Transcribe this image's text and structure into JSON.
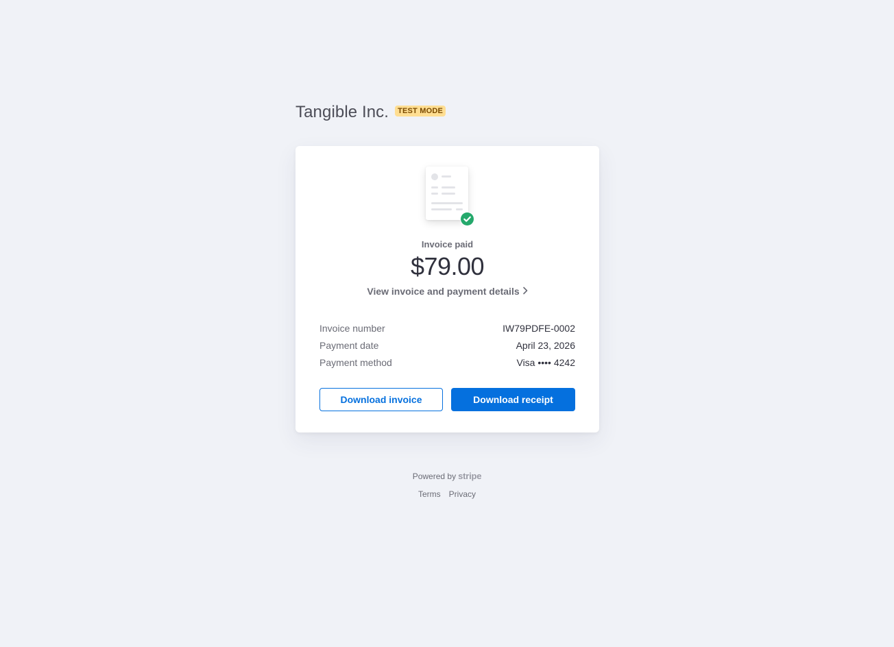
{
  "merchant": {
    "name": "Tangible Inc.",
    "badge": "TEST MODE"
  },
  "invoice": {
    "status": "Invoice paid",
    "amount": "$79.00",
    "details_link": "View invoice and payment details",
    "icons": {
      "document": "invoice-document-icon",
      "check": "check-circle-icon",
      "chevron": "chevron-right-icon"
    },
    "colors": {
      "accent": "#0570de",
      "success": "#24a86b",
      "badge_bg": "#ffde92"
    },
    "summary": [
      {
        "label": "Invoice number",
        "value": "IW79PDFE-0002"
      },
      {
        "label": "Payment date",
        "value": "April 23, 2026"
      },
      {
        "label": "Payment method",
        "value": "Visa •••• 4242"
      }
    ]
  },
  "actions": {
    "download_invoice": "Download invoice",
    "download_receipt": "Download receipt"
  },
  "footer": {
    "powered_by": "Powered by",
    "brand": "stripe",
    "terms": "Terms",
    "privacy": "Privacy"
  }
}
